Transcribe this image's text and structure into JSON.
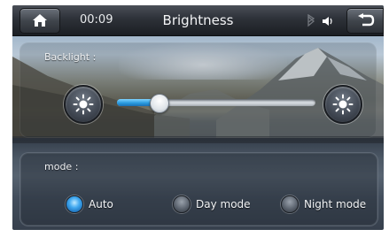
{
  "header": {
    "time": "00:09",
    "title": "Brightness"
  },
  "icons": {
    "home": "home-icon",
    "bluetooth": "bluetooth-icon",
    "volume": "speaker-icon",
    "back": "back-arrow-icon",
    "brightness_down": "sun-icon",
    "brightness_up": "sun-icon"
  },
  "backlight": {
    "label": "Backlight :",
    "level": 0.21
  },
  "mode": {
    "label": "mode :",
    "options": [
      {
        "label": "Auto",
        "selected": true
      },
      {
        "label": "Day mode",
        "selected": false
      },
      {
        "label": "Night mode",
        "selected": false
      }
    ]
  },
  "colors": {
    "accent": "#2a9be0",
    "topbar": "#2d3138"
  }
}
